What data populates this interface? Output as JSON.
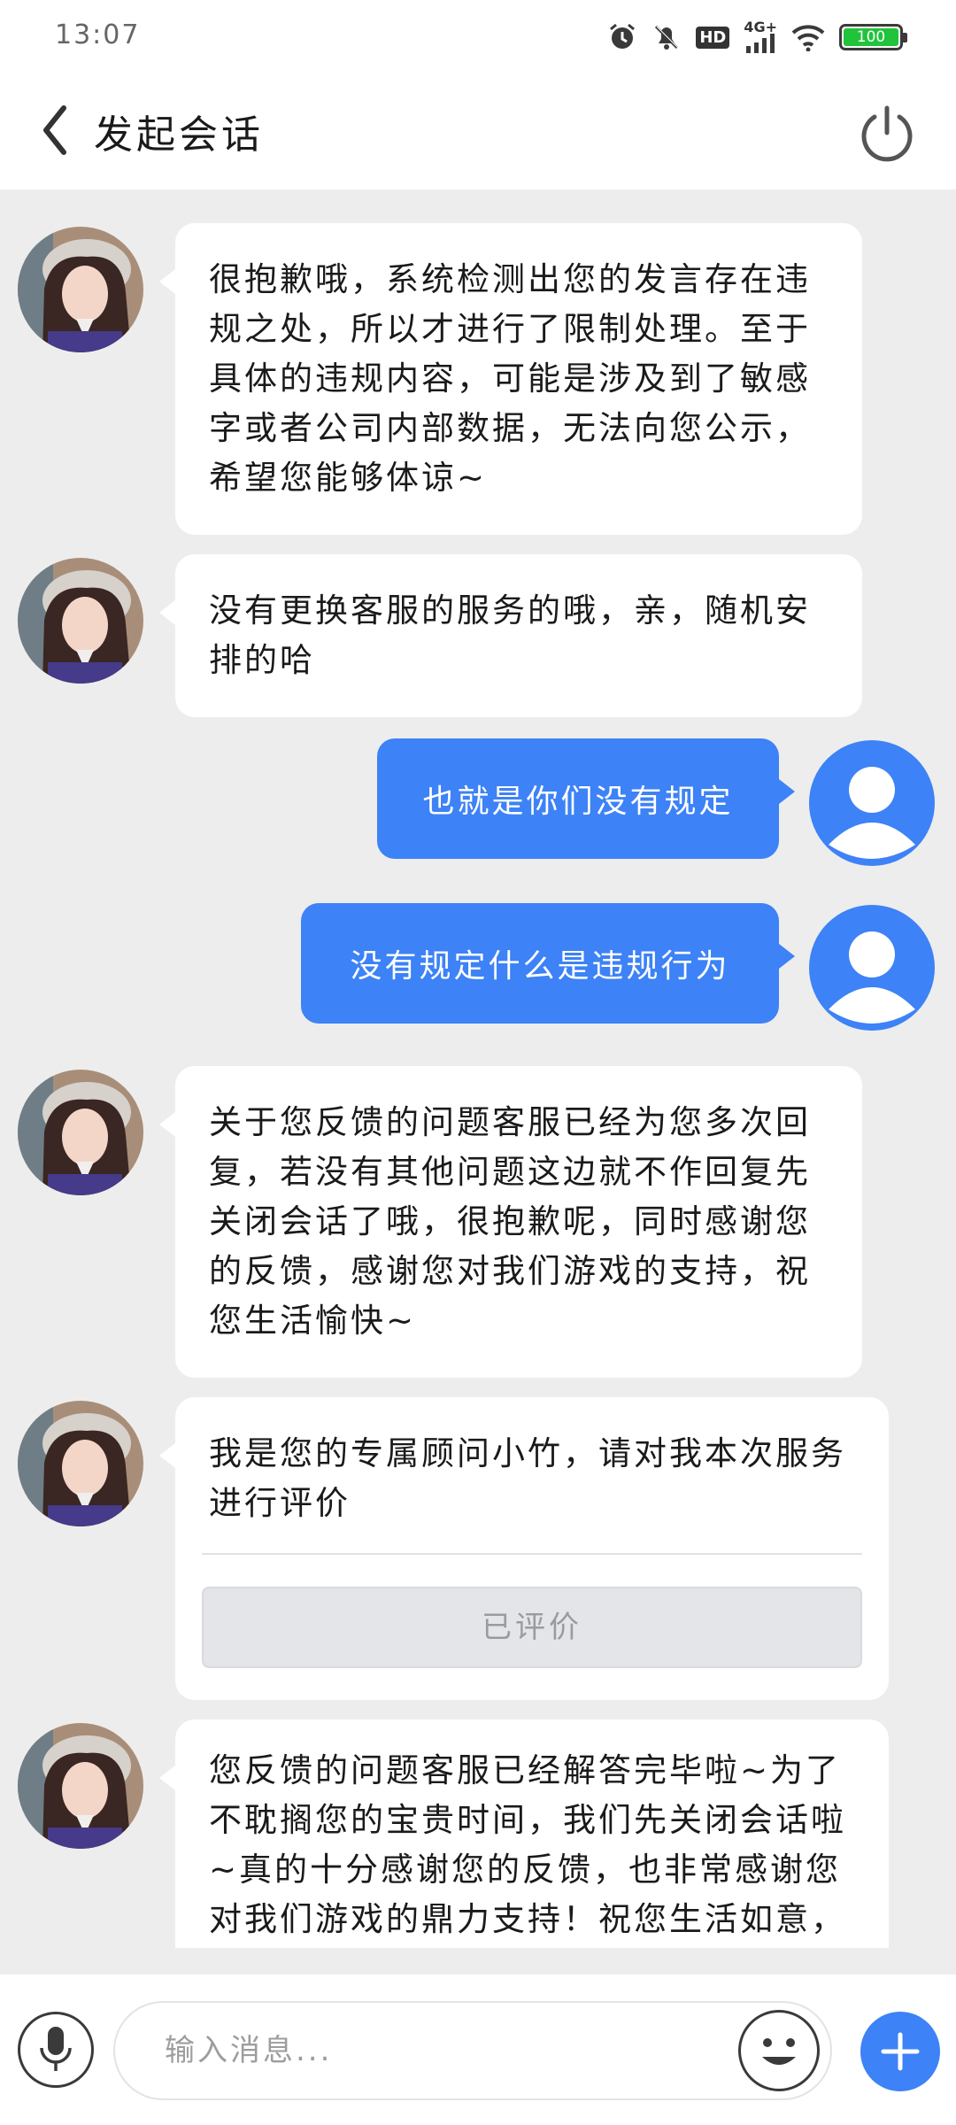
{
  "status_bar": {
    "time": "13:07",
    "network": "4G+",
    "hd": "HD",
    "battery": "100",
    "icons": [
      "alarm-icon",
      "mute-icon",
      "hd-icon",
      "signal-icon",
      "wifi-icon",
      "battery-icon"
    ]
  },
  "header": {
    "title": "发起会话",
    "back_icon": "chevron-left-icon",
    "power_icon": "power-icon"
  },
  "messages": [
    {
      "sender": "agent",
      "text": "很抱歉哦，系统检测出您的发言存在违规之处，所以才进行了限制处理。至于具体的违规内容，可能是涉及到了敏感字或者公司内部数据，无法向您公示，希望您能够体谅~"
    },
    {
      "sender": "agent",
      "text": "没有更换客服的服务的哦，亲，随机安排的哈"
    },
    {
      "sender": "user",
      "text": "也就是你们没有规定"
    },
    {
      "sender": "user",
      "text": "没有规定什么是违规行为"
    },
    {
      "sender": "agent",
      "text": "关于您反馈的问题客服已经为您多次回复，若没有其他问题这边就不作回复先关闭会话了哦，很抱歉呢，同时感谢您的反馈，感谢您对我们游戏的支持，祝您生活愉快~"
    },
    {
      "sender": "agent",
      "text": "我是您的专属顾问小竹，请对我本次服务进行评价",
      "button": "已评价"
    },
    {
      "sender": "agent",
      "text": "您反馈的问题客服已经解答完毕啦~为了不耽搁您的宝贵时间，我们先关闭会话啦~真的十分感谢您的反馈，也非常感谢您对我们游戏的鼎力支持！祝您生活如意，每天都有好心情~如果您之后遇到其他问题，欢迎随时联系我们哦"
    }
  ],
  "input": {
    "placeholder": "输入消息..."
  },
  "colors": {
    "accent": "#3d82f6",
    "background": "#ededed",
    "battery": "#20c33a"
  }
}
